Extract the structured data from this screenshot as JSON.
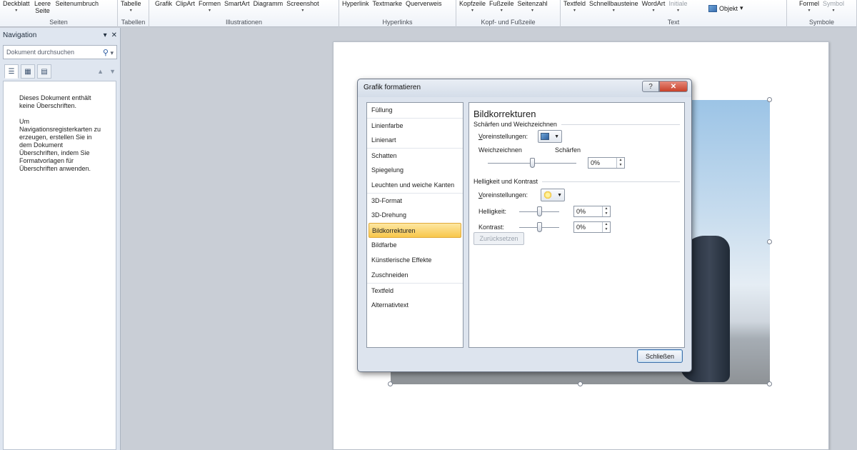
{
  "ribbon": {
    "groups": [
      {
        "name": "Seiten",
        "buttons": [
          {
            "label": "Deckblatt",
            "arrow": true
          },
          {
            "label": "Leere Seite"
          },
          {
            "label": "Seitenumbruch"
          }
        ]
      },
      {
        "name": "Tabellen",
        "buttons": [
          {
            "label": "Tabelle",
            "arrow": true
          }
        ]
      },
      {
        "name": "Illustrationen",
        "buttons": [
          {
            "label": "Grafik"
          },
          {
            "label": "ClipArt"
          },
          {
            "label": "Formen",
            "arrow": true
          },
          {
            "label": "SmartArt"
          },
          {
            "label": "Diagramm"
          },
          {
            "label": "Screenshot",
            "arrow": true
          }
        ]
      },
      {
        "name": "Hyperlinks",
        "buttons": [
          {
            "label": "Hyperlink"
          },
          {
            "label": "Textmarke"
          },
          {
            "label": "Querverweis"
          }
        ]
      },
      {
        "name": "Kopf- und Fußzeile",
        "buttons": [
          {
            "label": "Kopfzeile",
            "arrow": true
          },
          {
            "label": "Fußzeile",
            "arrow": true
          },
          {
            "label": "Seitenzahl",
            "arrow": true
          }
        ]
      },
      {
        "name": "Text",
        "buttons": [
          {
            "label": "Textfeld",
            "arrow": true
          },
          {
            "label": "Schnellbausteine",
            "arrow": true
          },
          {
            "label": "WordArt",
            "arrow": true
          },
          {
            "label": "Initiale",
            "arrow": true,
            "disabled": true
          }
        ],
        "extra": "Objekt"
      },
      {
        "name": "Symbole",
        "buttons": [
          {
            "label": "Formel",
            "arrow": true
          },
          {
            "label": "Symbol",
            "arrow": true,
            "disabled": true
          }
        ]
      }
    ]
  },
  "nav": {
    "title": "Navigation",
    "search_placeholder": "Dokument durchsuchen",
    "message1": "Dieses Dokument enthält keine Überschriften.",
    "message2": "Um Navigationsregisterkarten zu erzeugen, erstellen Sie in dem Dokument Überschriften, indem Sie Formatvorlagen für Überschriften anwenden."
  },
  "dialog": {
    "title": "Grafik formatieren",
    "categories": [
      {
        "label": "Füllung"
      },
      {
        "label": "Linienfarbe",
        "sep": true
      },
      {
        "label": "Linienart"
      },
      {
        "label": "Schatten",
        "sep": true
      },
      {
        "label": "Spiegelung"
      },
      {
        "label": "Leuchten und weiche Kanten"
      },
      {
        "label": "3D-Format",
        "sep": true
      },
      {
        "label": "3D-Drehung"
      },
      {
        "label": "Bildkorrekturen",
        "selected": true
      },
      {
        "label": "Bildfarbe"
      },
      {
        "label": "Künstlerische Effekte"
      },
      {
        "label": "Zuschneiden"
      },
      {
        "label": "Textfeld",
        "sep": true
      },
      {
        "label": "Alternativtext"
      }
    ],
    "panel": {
      "title": "Bildkorrekturen",
      "section1": "Schärfen und Weichzeichnen",
      "presets_label_1": "V",
      "presets_label_2": "oreinstellungen:",
      "soften_label": "Weichzeichnen",
      "sharpen_label": "Schärfen",
      "sharpen_value": "0%",
      "section2": "Helligkeit und Kontrast",
      "brightness_label": "Helligkeit:",
      "brightness_value": "0%",
      "contrast_label": "Kontrast:",
      "contrast_value": "0%",
      "reset_label": "Zurücksetzen"
    },
    "close_label": "Schließen",
    "help_label": "?",
    "x_label": "✕"
  }
}
